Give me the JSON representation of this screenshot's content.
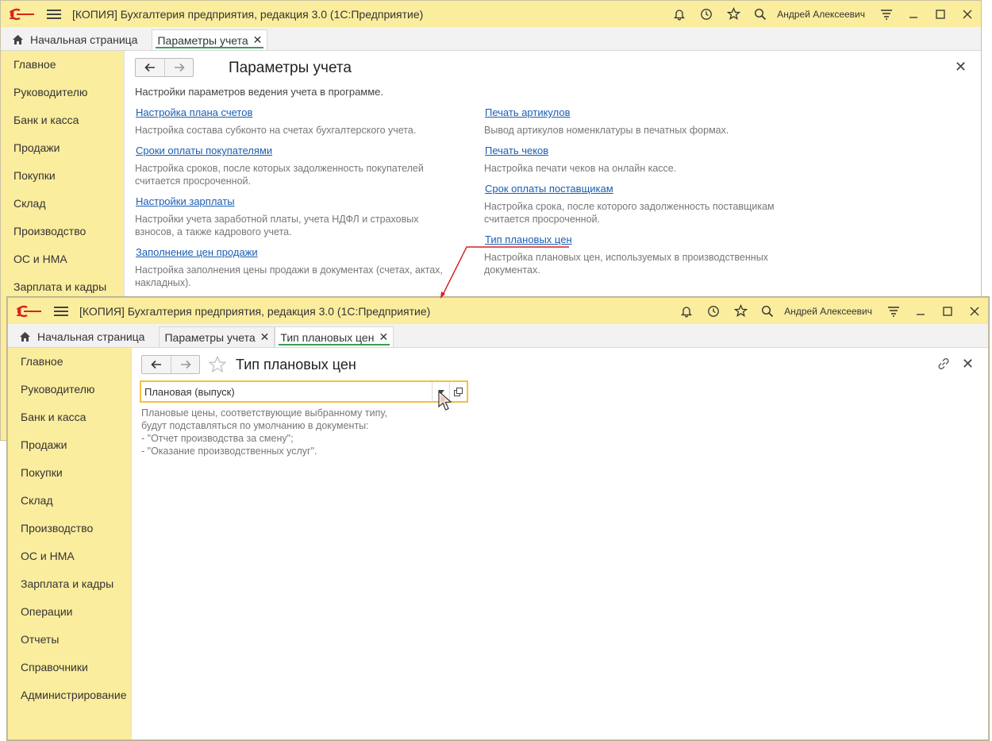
{
  "app_title": "[КОПИЯ] Бухгалтерия предприятия, редакция 3.0  (1С:Предприятие)",
  "user_name": "Андрей Алексеевич",
  "colors": {
    "titlebar": "#fbed9e",
    "accent_tab": "#3d9c54",
    "link": "#1a5eb4",
    "arrow": "#d81e1e",
    "field_focus": "#f3c23b"
  },
  "window1": {
    "tabs": [
      {
        "label": "Начальная страница"
      },
      {
        "label": "Параметры учета"
      }
    ],
    "sidebar": [
      "Главное",
      "Руководителю",
      "Банк и касса",
      "Продажи",
      "Покупки",
      "Склад",
      "Производство",
      "ОС и НМА",
      "Зарплата и кадры"
    ],
    "page_title": "Параметры учета",
    "description": "Настройки параметров ведения учета в программе.",
    "left_links": [
      {
        "link": "Настройка плана счетов",
        "text": "Настройка состава субконто на счетах бухгалтерского учета."
      },
      {
        "link": "Сроки оплаты покупателями",
        "text": "Настройка сроков, после которых задолженность покупателей считается просроченной."
      },
      {
        "link": "Настройки зарплаты",
        "text": "Настройки учета заработной платы, учета НДФЛ и страховых взносов, а также кадрового учета."
      },
      {
        "link": "Заполнение цен продажи",
        "text": "Настройка заполнения цены продажи в документах (счетах, актах, накладных)."
      }
    ],
    "right_links": [
      {
        "link": "Печать артикулов",
        "text": "Вывод артикулов номенклатуры в печатных формах."
      },
      {
        "link": "Печать чеков",
        "text": "Настройка печати чеков на онлайн кассе."
      },
      {
        "link": "Срок оплаты поставщикам",
        "text": "Настройка срока, после которого задолженность поставщикам считается просроченной."
      },
      {
        "link": "Тип плановых цен",
        "text": "Настройка плановых цен, используемых в производственных документах."
      }
    ]
  },
  "window2": {
    "tabs": [
      {
        "label": "Начальная страница"
      },
      {
        "label": "Параметры учета"
      },
      {
        "label": "Тип плановых цен"
      }
    ],
    "sidebar": [
      "Главное",
      "Руководителю",
      "Банк и касса",
      "Продажи",
      "Покупки",
      "Склад",
      "Производство",
      "ОС и НМА",
      "Зарплата и кадры",
      "Операции",
      "Отчеты",
      "Справочники",
      "Администрирование"
    ],
    "page_title": "Тип плановых цен",
    "field_value": "Плановая (выпуск)",
    "hint_lines": [
      "Плановые цены, соответствующие выбранному типу,",
      "будут подставляться по умолчанию в документы:",
      "- \"Отчет производства за смену\";",
      "- \"Оказание производственных услуг\"."
    ]
  }
}
